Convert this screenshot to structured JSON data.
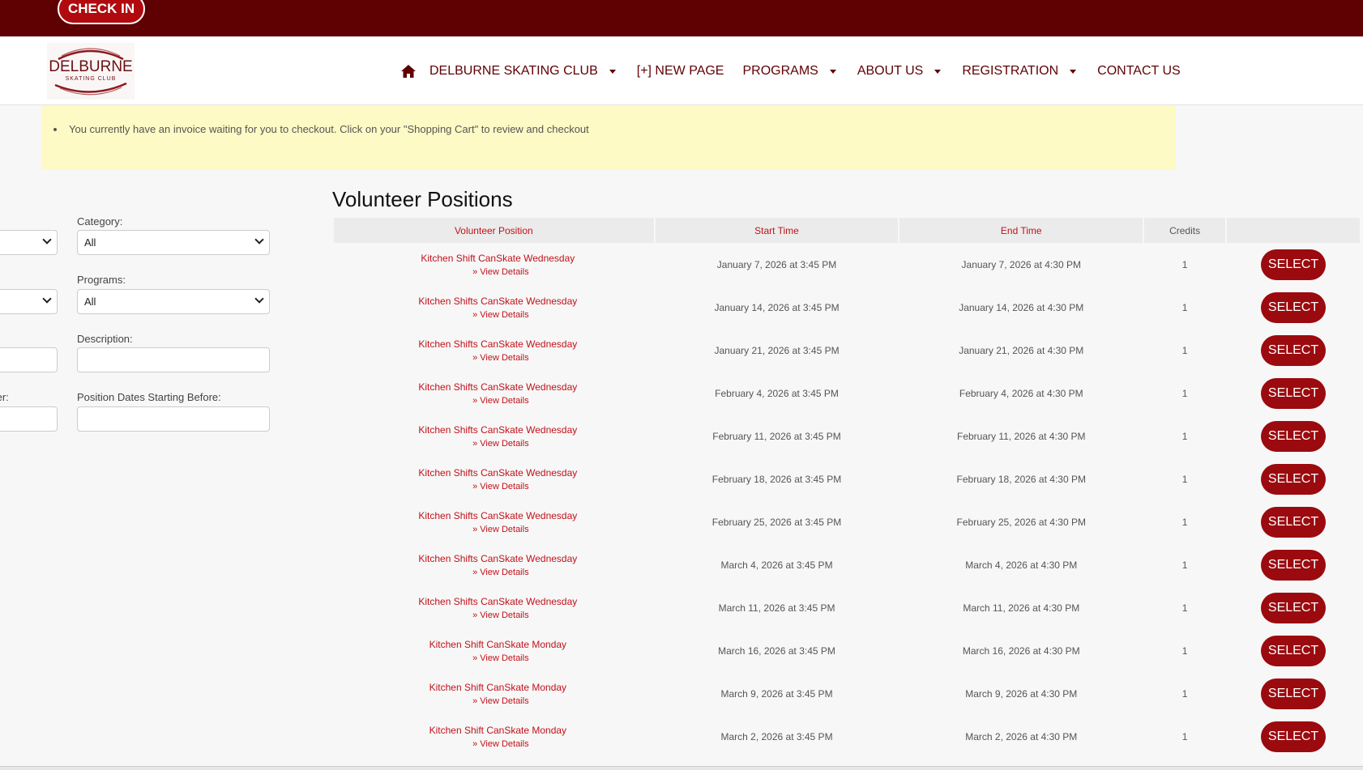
{
  "header": {
    "check_in_label": "CHECK IN"
  },
  "logo": {
    "name": "DELBURNE",
    "subtitle": "SKATING CLUB"
  },
  "nav": {
    "items": [
      {
        "label": "DELBURNE SKATING CLUB",
        "dropdown": true
      },
      {
        "label": "[+] NEW PAGE",
        "dropdown": false
      },
      {
        "label": "PROGRAMS",
        "dropdown": true
      },
      {
        "label": "ABOUT US",
        "dropdown": true
      },
      {
        "label": "REGISTRATION",
        "dropdown": true
      },
      {
        "label": "CONTACT US",
        "dropdown": false
      }
    ]
  },
  "notice": {
    "text": "You currently have an invoice waiting for you to checkout. Click on your \"Shopping Cart\" to review and checkout"
  },
  "filters": {
    "category_label": "Category:",
    "category_value": "All",
    "programs_label": "Programs:",
    "programs_value": "All",
    "description_label": "Description:",
    "description_value": "",
    "dates_before_label": "Position Dates Starting Before:",
    "dates_before_value": "",
    "left_partial_label": "ter:"
  },
  "main": {
    "title": "Volunteer Positions",
    "columns": [
      "Volunteer Position",
      "Start Time",
      "End Time",
      "Credits",
      ""
    ],
    "view_details_label": "» View Details",
    "select_label": "SELECT",
    "rows": [
      {
        "position": "Kitchen Shift CanSkate Wednesday",
        "start": "January 7, 2026 at 3:45 PM",
        "end": "January 7, 2026 at 4:30 PM",
        "credits": "1"
      },
      {
        "position": "Kitchen Shifts CanSkate Wednesday",
        "start": "January 14, 2026 at 3:45 PM",
        "end": "January 14, 2026 at 4:30 PM",
        "credits": "1"
      },
      {
        "position": "Kitchen Shifts CanSkate Wednesday",
        "start": "January 21, 2026 at 3:45 PM",
        "end": "January 21, 2026 at 4:30 PM",
        "credits": "1"
      },
      {
        "position": "Kitchen Shifts CanSkate Wednesday",
        "start": "February 4, 2026 at 3:45 PM",
        "end": "February 4, 2026 at 4:30 PM",
        "credits": "1"
      },
      {
        "position": "Kitchen Shifts CanSkate Wednesday",
        "start": "February 11, 2026 at 3:45 PM",
        "end": "February 11, 2026 at 4:30 PM",
        "credits": "1"
      },
      {
        "position": "Kitchen Shifts CanSkate Wednesday",
        "start": "February 18, 2026 at 3:45 PM",
        "end": "February 18, 2026 at 4:30 PM",
        "credits": "1"
      },
      {
        "position": "Kitchen Shifts CanSkate Wednesday",
        "start": "February 25, 2026 at 3:45 PM",
        "end": "February 25, 2026 at 4:30 PM",
        "credits": "1"
      },
      {
        "position": "Kitchen Shifts CanSkate Wednesday",
        "start": "March 4, 2026 at 3:45 PM",
        "end": "March 4, 2026 at 4:30 PM",
        "credits": "1"
      },
      {
        "position": "Kitchen Shifts CanSkate Wednesday",
        "start": "March 11, 2026 at 3:45 PM",
        "end": "March 11, 2026 at 4:30 PM",
        "credits": "1"
      },
      {
        "position": "Kitchen Shift CanSkate Monday",
        "start": "March 16, 2026 at 3:45 PM",
        "end": "March 16, 2026 at 4:30 PM",
        "credits": "1"
      },
      {
        "position": "Kitchen Shift CanSkate Monday",
        "start": "March 9, 2026 at 3:45 PM",
        "end": "March 9, 2026 at 4:30 PM",
        "credits": "1"
      },
      {
        "position": "Kitchen Shift CanSkate Monday",
        "start": "March 2, 2026 at 3:45 PM",
        "end": "March 2, 2026 at 4:30 PM",
        "credits": "1"
      }
    ]
  },
  "colors": {
    "brand_dark": "#5f0003",
    "accent_red": "#c1121a",
    "button_red": "#9b0a0e",
    "notice_bg": "#fefac5"
  },
  "icons": {
    "home": "home-icon",
    "caret": "caret-down-icon"
  }
}
